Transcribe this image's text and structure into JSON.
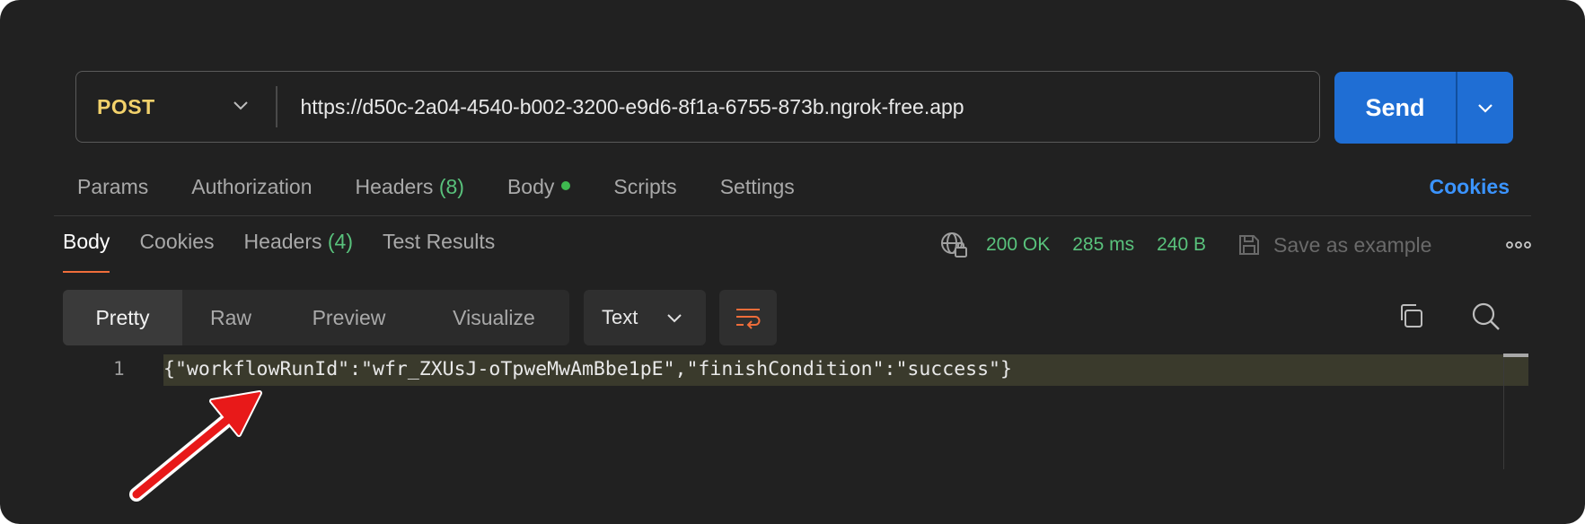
{
  "request": {
    "method": "POST",
    "url": "https://d50c-2a04-4540-b002-3200-e9d6-8f1a-6755-873b.ngrok-free.app",
    "send_label": "Send"
  },
  "request_tabs": {
    "params": "Params",
    "authorization": "Authorization",
    "headers": "Headers",
    "headers_count": "(8)",
    "body": "Body",
    "scripts": "Scripts",
    "settings": "Settings",
    "cookies": "Cookies"
  },
  "response_tabs": {
    "body": "Body",
    "cookies": "Cookies",
    "headers": "Headers",
    "headers_count": "(4)",
    "test_results": "Test Results"
  },
  "response_status": {
    "status": "200 OK",
    "time": "285 ms",
    "size": "240 B",
    "save_example": "Save as example"
  },
  "view_modes": {
    "pretty": "Pretty",
    "raw": "Raw",
    "preview": "Preview",
    "visualize": "Visualize",
    "format": "Text"
  },
  "code": {
    "line_number": "1",
    "content": "{\"workflowRunId\":\"wfr_ZXUsJ-oTpweMwAmBbe1pE\",\"finishCondition\":\"success\"}"
  },
  "colors": {
    "background": "#212121",
    "method": "#f2d16b",
    "send": "#1f6ed4",
    "status_green": "#59c27c",
    "cookies_link": "#3b94ff",
    "active_underline": "#f06d3a",
    "annotation_arrow": "#e81919"
  }
}
